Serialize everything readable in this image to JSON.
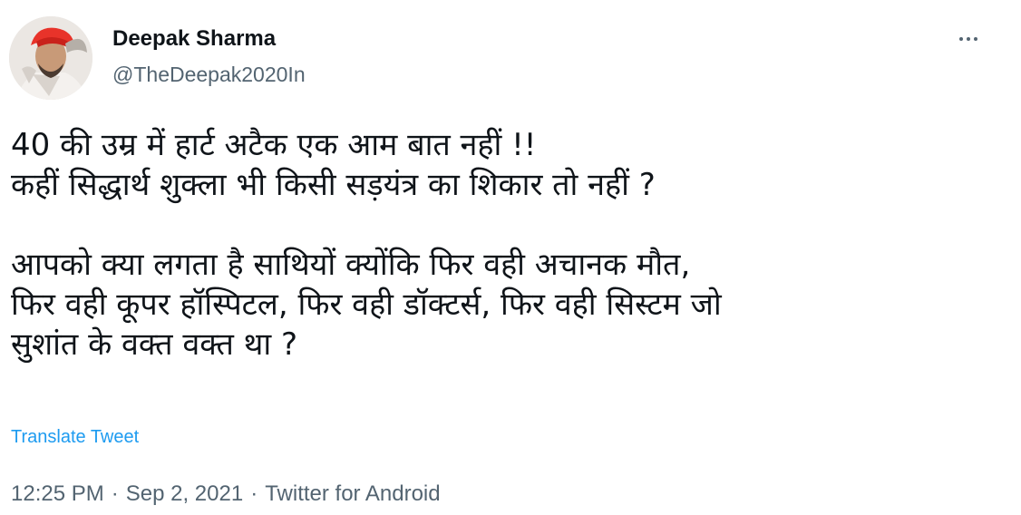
{
  "author": {
    "name": "Deepak Sharma",
    "handle": "@TheDeepak2020In"
  },
  "tweet": {
    "lines": [
      "40 की उम्र में हार्ट अटैक एक आम बात नहीं !!",
      "कहीं सिद्धार्थ शुक्ला भी किसी सड़यंत्र का शिकार तो नहीं ?",
      "आपको क्या लगता है साथियों क्योंकि फिर वही अचानक मौत,",
      "फिर वही कूपर हॉस्पिटल, फिर वही डॉक्टर्स, फिर वही सिस्टम जो",
      "सुशांत के वक्त वक्त था ?"
    ],
    "translate_label": "Translate Tweet"
  },
  "meta": {
    "time": "12:25 PM",
    "date": "Sep 2, 2021",
    "source": "Twitter for Android",
    "separator": "·"
  },
  "icons": {
    "more": "more-horizontal-icon",
    "avatar": "avatar-photo"
  },
  "colors": {
    "text": "#0f1419",
    "secondary": "#536471",
    "link": "#1d9bf0"
  }
}
